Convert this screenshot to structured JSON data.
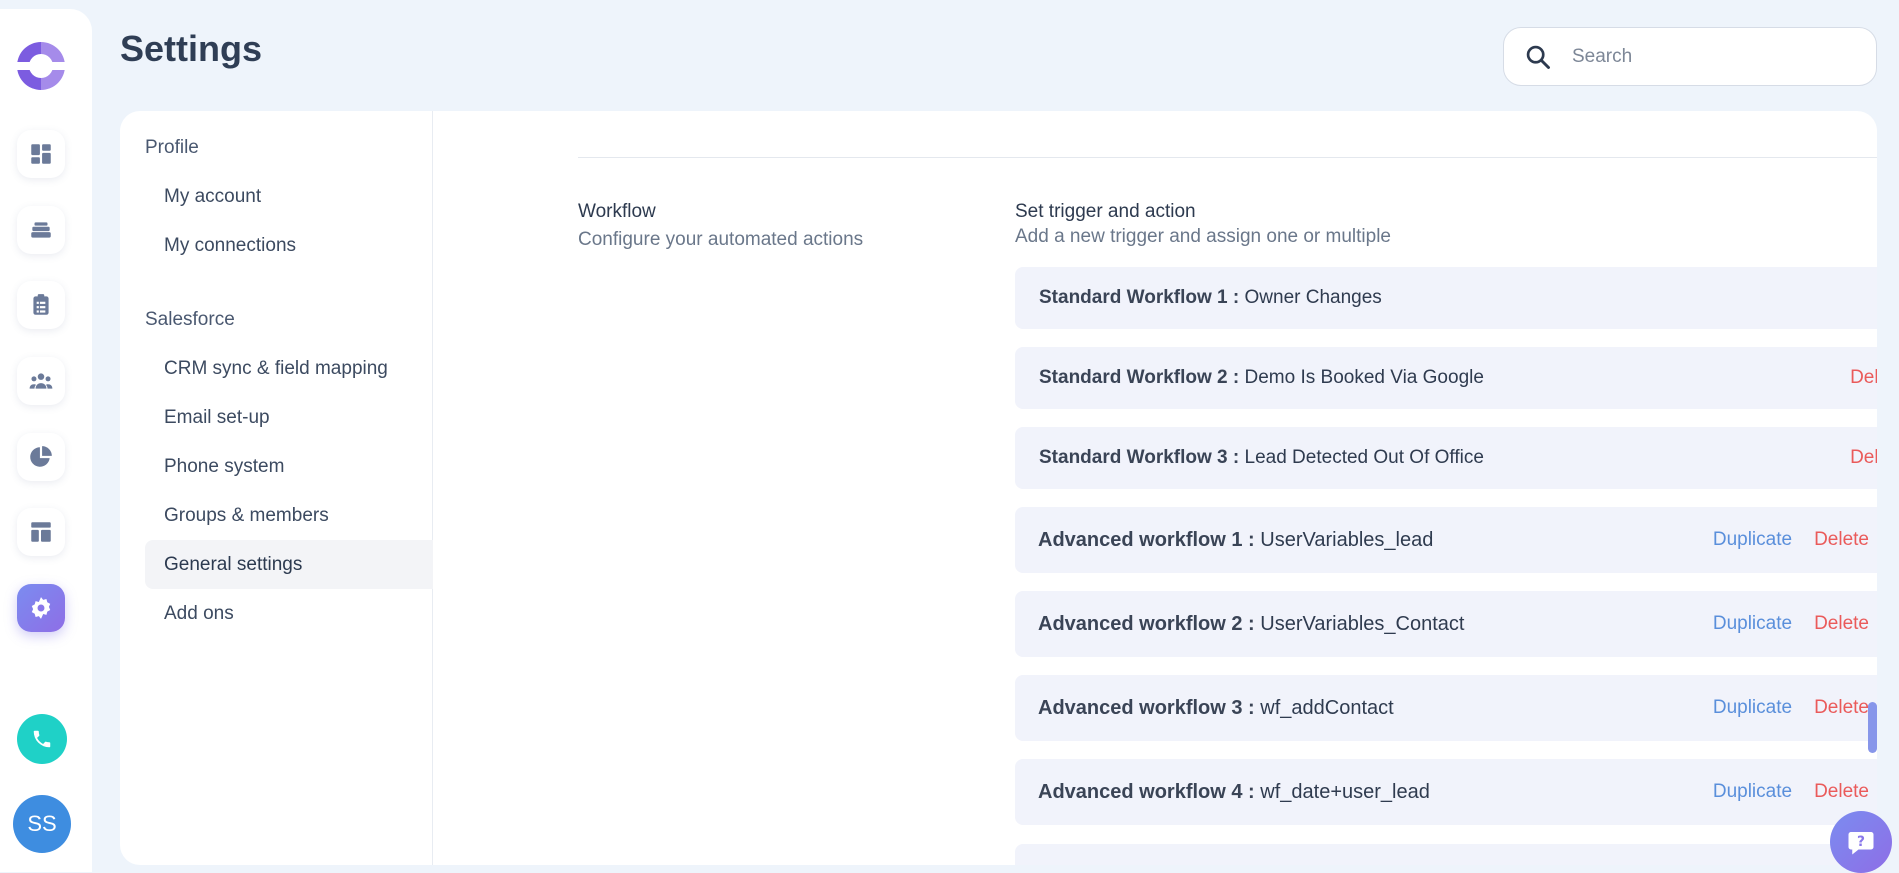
{
  "header": {
    "title": "Settings",
    "search_placeholder": "Search"
  },
  "rail": {
    "icons": [
      "app-logo",
      "dashboard-icon",
      "inbox-stack-icon",
      "clipboard-list-icon",
      "team-icon",
      "pie-chart-icon",
      "layout-icon",
      "gear-icon",
      "phone-icon"
    ],
    "active": "gear-icon",
    "avatar_initials": "SS"
  },
  "side_nav": {
    "profile_heading": "Profile",
    "profile_items": [
      "My account",
      "My connections"
    ],
    "salesforce_heading": "Salesforce",
    "salesforce_items": [
      "CRM sync & field mapping",
      "Email set-up",
      "Phone system",
      "Groups & members",
      "General settings",
      "Add ons"
    ],
    "active_item": "General settings"
  },
  "workflow_section": {
    "title": "Workflow",
    "description": "Configure your automated actions",
    "trigger_title": "Set trigger and action",
    "trigger_description": "Add a new trigger and assign one or multiple"
  },
  "standard_workflows": [
    {
      "label": "Standard Workflow 1 :",
      "name": "Owner Changes",
      "delete": ""
    },
    {
      "label": "Standard Workflow 2 :",
      "name": "Demo Is Booked Via Google",
      "delete": "Delete"
    },
    {
      "label": "Standard Workflow 3 :",
      "name": "Lead Detected Out Of Office",
      "delete": "Delete"
    }
  ],
  "advanced_workflows": [
    {
      "label": "Advanced workflow 1 :",
      "name": "UserVariables_lead",
      "duplicate": "Duplicate",
      "delete": "Delete",
      "enabled": false
    },
    {
      "label": "Advanced workflow 2 :",
      "name": "UserVariables_Contact",
      "duplicate": "Duplicate",
      "delete": "Delete",
      "enabled": false
    },
    {
      "label": "Advanced workflow 3 :",
      "name": "wf_addContact",
      "duplicate": "Duplicate",
      "delete": "Delete",
      "enabled": false
    },
    {
      "label": "Advanced workflow 4 :",
      "name": "wf_date+user_lead",
      "duplicate": "Duplicate",
      "delete": "Delete",
      "enabled": false
    }
  ],
  "colors": {
    "accent": "#8e6ee6",
    "delete": "#ea5a5a",
    "duplicate": "#5a8fdb",
    "phone": "#1fd1c7"
  }
}
